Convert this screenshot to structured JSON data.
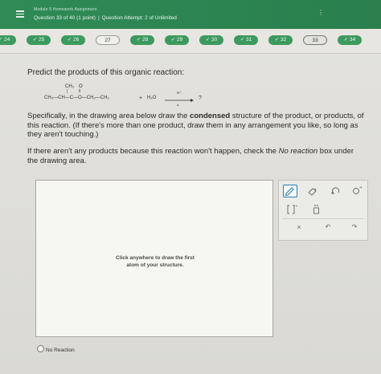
{
  "header": {
    "module_title": "Module 5 Homework Assignment",
    "question_number": "Question 33 of 40 (1 point)",
    "attempt": "Question Attempt: 2 of Unlimited",
    "menu_icon": "hamburger-menu-icon",
    "more_icon": "vertical-ellipsis-icon",
    "more_glyph": "⋮",
    "separator": "|"
  },
  "nav": {
    "questions": [
      {
        "label": "24",
        "status": "done"
      },
      {
        "label": "25",
        "status": "done"
      },
      {
        "label": "26",
        "status": "done"
      },
      {
        "label": "27",
        "status": "todo"
      },
      {
        "label": "28",
        "status": "done"
      },
      {
        "label": "29",
        "status": "done"
      },
      {
        "label": "30",
        "status": "done"
      },
      {
        "label": "31",
        "status": "done"
      },
      {
        "label": "32",
        "status": "done"
      },
      {
        "label": "33",
        "status": "current"
      },
      {
        "label": "34",
        "status": "done"
      }
    ],
    "check_glyph": "✓"
  },
  "question": {
    "prompt": "Predict the products of this organic reaction:",
    "reaction": {
      "ch3_top": "CH₃",
      "o_top": "O",
      "main_chain": "CH₃—CH—C—O—CH₂—CH₃",
      "plus": "+",
      "water": "H₂O",
      "catalyst": "H⁺",
      "heat": "Δ",
      "product": "?"
    },
    "spec_before": "Specifically, in the drawing area below draw the ",
    "spec_bold": "condensed",
    "spec_after": " structure of the product, or products, of this reaction. (If there's more than one product, draw them in any arrangement you like, so long as they aren't touching.)",
    "noprod_before": "If there aren't any products because this reaction won't happen, check the ",
    "noprod_italic": "No reaction",
    "noprod_after": " box under the drawing area."
  },
  "drawing": {
    "hint_line1": "Click anywhere to draw the first",
    "hint_line2": "atom of your structure."
  },
  "toolbar": {
    "pencil_icon": "pencil-icon",
    "eraser_icon": "eraser-icon",
    "undo_icon": "undo-arc-icon",
    "charge_icon": "charge-circle-icon",
    "bracket_icon": "bracket-icon",
    "lone_pair_icon": "lone-pair-icon",
    "clear_glyph": "×",
    "undo_glyph": "↶",
    "redo_glyph": "↷"
  },
  "no_reaction": {
    "label": "No Reaction"
  },
  "colors": {
    "header_green": "#2f8a56",
    "done_pill": "#3d9a5f",
    "pencil_blue": "#2a7fb8"
  }
}
